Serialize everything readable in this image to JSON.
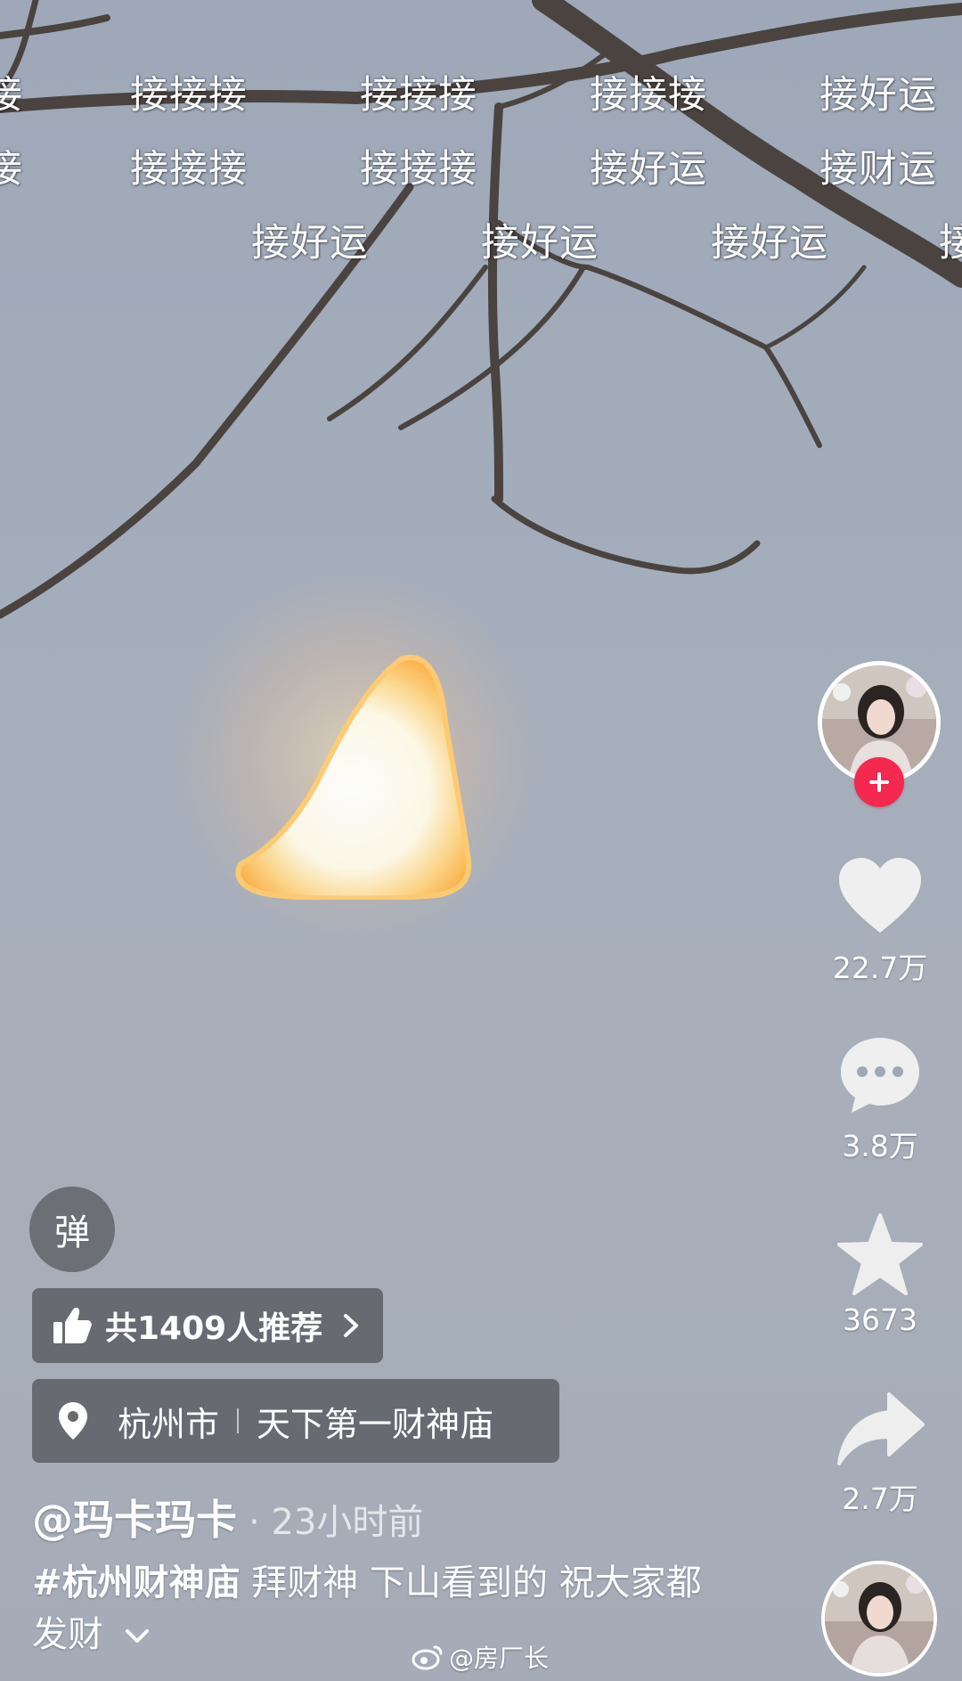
{
  "danmaku": {
    "row1": [
      "接",
      "接接接",
      "接接接",
      "接接接",
      "接好运"
    ],
    "row2": [
      "接",
      "接接接",
      "接接接",
      "接好运",
      "接财运"
    ],
    "row3": [
      "接好运",
      "接好运",
      "接好运",
      "接"
    ]
  },
  "creator": {
    "follow_icon": "plus-icon"
  },
  "actions": {
    "likes": "22.7万",
    "comments": "3.8万",
    "favorites": "3673",
    "shares": "2.7万"
  },
  "danmaku_toggle": {
    "label": "弹"
  },
  "recommend": {
    "text": "共1409人推荐",
    "icon": "thumbs-up-icon"
  },
  "location": {
    "city": "杭州市",
    "place": "天下第一财神庙",
    "icon": "location-pin-icon"
  },
  "post": {
    "author": "@玛卡玛卡",
    "time": "· 23小时前",
    "hashtag": "#杭州财神庙",
    "caption": " 拜财神 下山看到的 祝大家都发财"
  },
  "watermark": {
    "text": "@房厂长",
    "icon": "weibo-icon"
  },
  "colors": {
    "accent_red": "#f5284f",
    "pill_bg": "#505055"
  }
}
